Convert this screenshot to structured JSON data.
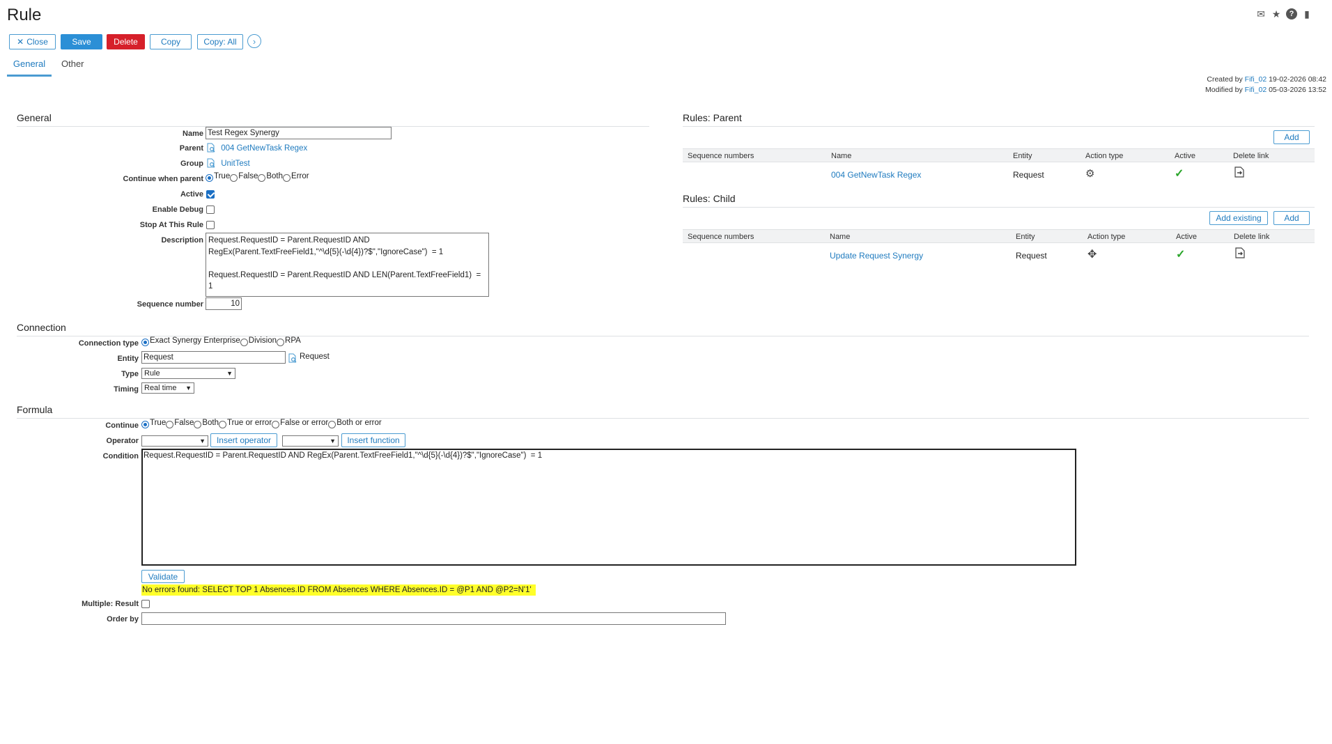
{
  "page": {
    "title": "Rule"
  },
  "toolbar": {
    "close_label": "Close",
    "save_label": "Save",
    "delete_label": "Delete",
    "copy_label": "Copy",
    "copy_all_label": "Copy: All"
  },
  "tabs": [
    {
      "label": "General"
    },
    {
      "label": "Other"
    }
  ],
  "meta": {
    "created_prefix": "Created by",
    "created_user": "Fifi_02",
    "created_date": "19-02-2026 08:42",
    "modified_prefix": "Modified by",
    "modified_user": "Fifi_02",
    "modified_date": "05-03-2026 13:52"
  },
  "general": {
    "title": "General",
    "name_label": "Name",
    "name_value": "Test Regex Synergy",
    "parent_label": "Parent",
    "parent_value": "004 GetNewTask Regex",
    "group_label": "Group",
    "group_value": "UnitTest",
    "continue_label": "Continue when parent",
    "continue_options": [
      "True",
      "False",
      "Both",
      "Error"
    ],
    "continue_selected": "True",
    "active_label": "Active",
    "active_checked": true,
    "debug_label": "Enable Debug",
    "debug_checked": false,
    "stop_label": "Stop At This Rule",
    "stop_checked": false,
    "description_label": "Description",
    "description_value": "Request.RequestID = Parent.RequestID AND RegEx(Parent.TextFreeField1,\"^\\d{5}(-\\d{4})?$\",\"IgnoreCase\")  = 1\n\nRequest.RequestID = Parent.RequestID AND LEN(Parent.TextFreeField1)  = 1",
    "sequence_label": "Sequence number",
    "sequence_value": "10"
  },
  "rules_parent": {
    "title": "Rules: Parent",
    "add_label": "Add",
    "columns": [
      "Sequence numbers",
      "Name",
      "Entity",
      "Action type",
      "Active",
      "Delete link"
    ],
    "rows": [
      {
        "sequence": "",
        "name": "004 GetNewTask Regex",
        "entity": "Request",
        "action_icon": "gears-icon",
        "active": true
      }
    ]
  },
  "rules_child": {
    "title": "Rules: Child",
    "add_existing_label": "Add existing",
    "add_label": "Add",
    "columns": [
      "Sequence numbers",
      "Name",
      "Entity",
      "Action type",
      "Active",
      "Delete link"
    ],
    "rows": [
      {
        "sequence": "",
        "name": "Update Request Synergy",
        "entity": "Request",
        "action_icon": "move-icon",
        "active": true
      }
    ]
  },
  "connection": {
    "title": "Connection",
    "type_label": "Connection type",
    "type_options": [
      "Exact Synergy Enterprise",
      "Division",
      "RPA"
    ],
    "type_selected": "Exact Synergy Enterprise",
    "entity_label": "Entity",
    "entity_value": "Request",
    "entity_lookup_text": "Request",
    "type2_label": "Type",
    "type2_value": "Rule",
    "timing_label": "Timing",
    "timing_value": "Real time"
  },
  "formula": {
    "title": "Formula",
    "continue_label": "Continue",
    "continue_options": [
      "True",
      "False",
      "Both",
      "True or error",
      "False or error",
      "Both or error"
    ],
    "continue_selected": "True",
    "operator_label": "Operator",
    "insert_operator_label": "Insert operator",
    "insert_function_label": "Insert function",
    "condition_label": "Condition",
    "condition_value": "Request.RequestID = Parent.RequestID AND RegEx(Parent.TextFreeField1,\"^\\d{5}(-\\d{4})?$\",\"IgnoreCase\")  = 1",
    "validate_label": "Validate",
    "validation_message": "No errors found: SELECT TOP 1 Absences.ID FROM Absences WHERE Absences.ID = @P1 AND @P2=N'1'",
    "multiple_label": "Multiple: Result",
    "multiple_checked": false,
    "order_label": "Order by",
    "order_value": ""
  }
}
